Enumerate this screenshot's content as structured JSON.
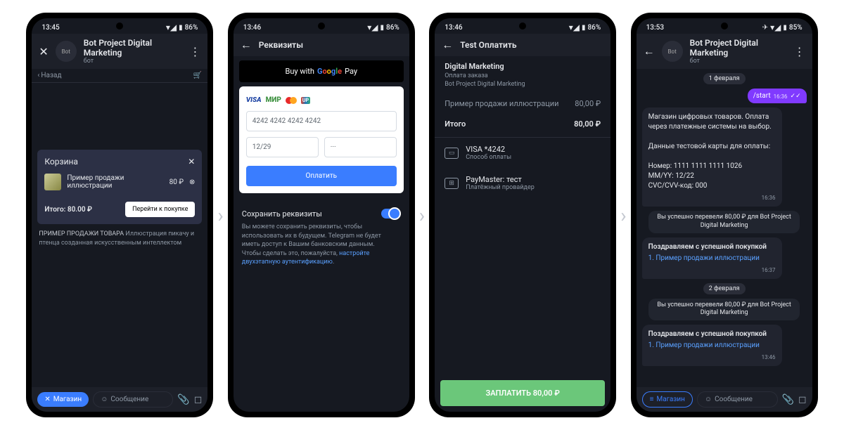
{
  "status": {
    "s1_time": "13:45",
    "s2_time": "13:46",
    "s3_time": "13:46",
    "s4_time": "13:53",
    "b1": "86%",
    "b2": "86%",
    "b3": "86%",
    "b4": "85%"
  },
  "s1": {
    "title": "Bot Project Digital Marketing",
    "sub": "бот",
    "back": "Назад",
    "cart_title": "Корзина",
    "item_name": "Пример продажи иллюстрации",
    "item_price": "80 ₽",
    "total": "Итого: 80.00 ₽",
    "checkout": "Перейти к покупке",
    "cap1": "ПРИМЕР ПРОДАЖИ ТОВАРА",
    "cap2": "Иллюстрация пикачу и птенца созданная искусственным интеллектом",
    "store": "Магазин",
    "msg_ph": "Сообщение"
  },
  "s2": {
    "title": "Реквизиты",
    "gpay": "Buy with",
    "card_no": "4242 4242 4242 4242",
    "exp": "12/29",
    "cvc": "···",
    "pay": "Оплатить",
    "save": "Сохранить реквизиты",
    "note1": "Вы можете сохранить реквизиты, чтобы использовать их в будущем. Telegram не будет иметь доступ к Вашим банковским данным.",
    "note2a": "Чтобы сделать это, пожалуйста, ",
    "note2b": "настройте двухэтапную аутентификацию",
    "note2c": "."
  },
  "s3": {
    "title": "Test Оплатить",
    "h1": "Digital Marketing",
    "h2": "Оплата заказа",
    "h3": "Bot Project Digital Marketing",
    "item": "Пример продажи иллюстрации",
    "item_price": "80,00 ₽",
    "total_lbl": "Итого",
    "total_val": "80,00 ₽",
    "method": "VISA *4242",
    "method_sub": "Способ оплаты",
    "provider": "PayMaster: тест",
    "provider_sub": "Платёжный провайдер",
    "pay": "ЗАПЛАТИТЬ 80,00 ₽"
  },
  "s4": {
    "title": "Bot Project Digital Marketing",
    "sub": "бот",
    "date1": "1 февраля",
    "start": "/start",
    "start_t": "16:36",
    "m1": "Магазин цифровых товаров. Оплата через платежные системы на выбор.",
    "m2": "Данные тестовой карты для оплаты:",
    "m3a": "Номер: 1111 1111 1111 1026",
    "m3b": "MM/YY: 12/22",
    "m3c": "CVC/CVV-код: 000",
    "m_t1": "16:36",
    "svc1": "Вы успешно перевели 80,00 ₽ для Bot Project Digital Marketing",
    "m4a": "Поздравляем с успешной покупкой",
    "m4b": "1. Пример продажи иллюстрации",
    "m_t2": "16:37",
    "date2": "2 февраля",
    "svc2": "Вы успешно перевели 80,00 ₽ для Bot Project Digital Marketing",
    "m5a": "Поздравляем с успешной покупкой",
    "m5b": "1. Пример продажи иллюстрации",
    "m_t3": "13:46",
    "store": "Магазин",
    "msg_ph": "Сообщение"
  }
}
